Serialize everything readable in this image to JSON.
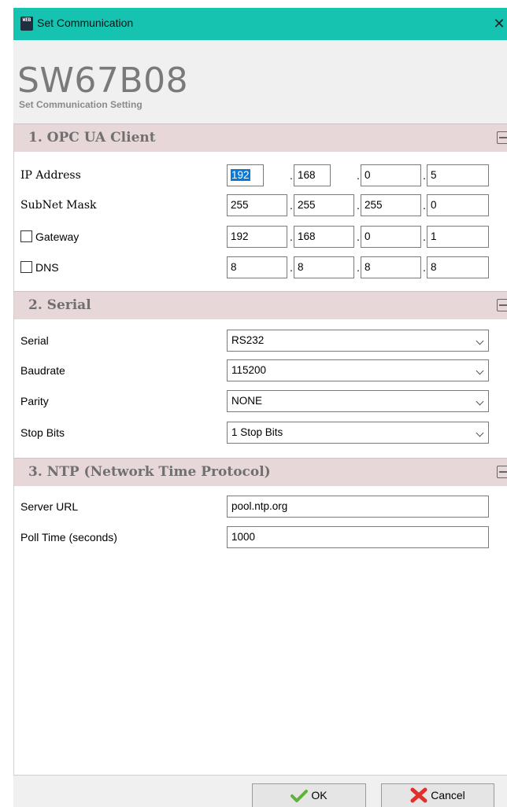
{
  "window": {
    "title": "Set Communication",
    "icon_text": "WEB",
    "close_icon": "close-icon"
  },
  "header": {
    "product": "SW67B08",
    "subtitle": "Set Communication Setting"
  },
  "sections": {
    "opc": {
      "title": "1. OPC UA Client",
      "ip_label": "IP Address",
      "ip": [
        "192",
        "168",
        "0",
        "5"
      ],
      "subnet_label": "SubNet Mask",
      "subnet": [
        "255",
        "255",
        "255",
        "0"
      ],
      "gateway_label": "Gateway",
      "gateway_checked": false,
      "gateway": [
        "192",
        "168",
        "0",
        "1"
      ],
      "dns_label": "DNS",
      "dns_checked": false,
      "dns": [
        "8",
        "8",
        "8",
        "8"
      ]
    },
    "serial": {
      "title": "2. Serial",
      "serial_label": "Serial",
      "serial_value": "RS232",
      "baud_label": "Baudrate",
      "baud_value": "115200",
      "parity_label": "Parity",
      "parity_value": "NONE",
      "stop_label": "Stop Bits",
      "stop_value": "1 Stop Bits"
    },
    "ntp": {
      "title": "3. NTP (Network Time Protocol)",
      "server_label": "Server URL",
      "server_value": "pool.ntp.org",
      "poll_label": "Poll Time (seconds)",
      "poll_value": "1000"
    }
  },
  "footer": {
    "ok_label": "OK",
    "cancel_label": "Cancel"
  },
  "colors": {
    "titlebar": "#16c3b1",
    "section_header": "#e7d7d9",
    "selection": "#0a78d7"
  }
}
